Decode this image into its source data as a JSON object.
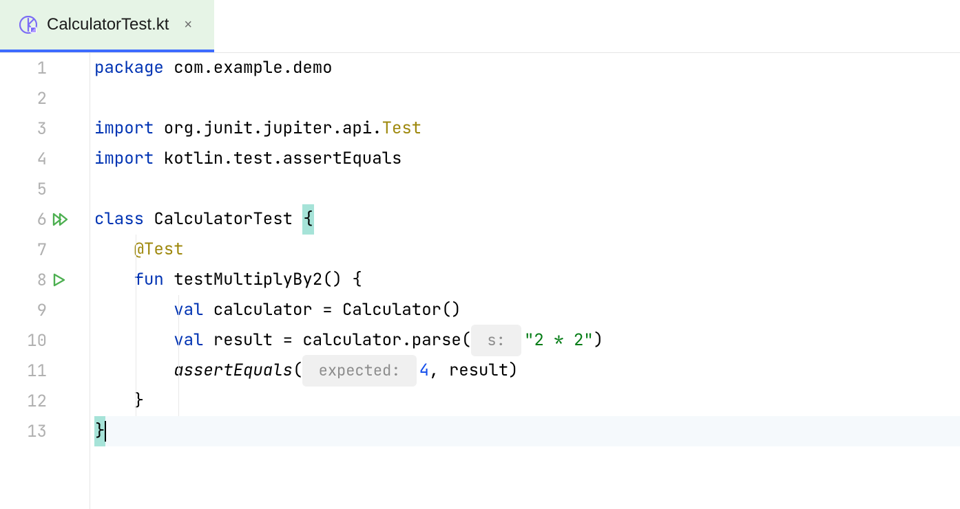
{
  "tab": {
    "filename": "CalculatorTest.kt",
    "close_glyph": "×"
  },
  "gutter": {
    "lines": [
      "1",
      "2",
      "3",
      "4",
      "5",
      "6",
      "7",
      "8",
      "9",
      "10",
      "11",
      "12",
      "13"
    ]
  },
  "code": {
    "l1": {
      "package_kw": "package",
      "pkg": " com.example.demo"
    },
    "l3": {
      "import_kw": "import",
      "path": " org.junit.jupiter.api.",
      "tail": "Test"
    },
    "l4": {
      "import_kw": "import",
      "path": " kotlin.test.assertEquals"
    },
    "l6": {
      "class_kw": "class",
      "name": " CalculatorTest ",
      "brace": "{"
    },
    "l7": {
      "indent": "    ",
      "anno": "@Test"
    },
    "l8": {
      "indent": "    ",
      "fun_kw": "fun",
      "name": " testMultiplyBy2() {"
    },
    "l9": {
      "indent": "        ",
      "val_kw": "val",
      "rest1": " calculator = Calculator()"
    },
    "l10": {
      "indent": "        ",
      "val_kw": "val",
      "rest1": " result = calculator.parse(",
      "hint": " s: ",
      "str": "\"2 * 2\"",
      "rest2": ")"
    },
    "l11": {
      "indent": "        ",
      "call": "assertEquals",
      "open": "(",
      "hint": " expected: ",
      "num": "4",
      "rest": ", result)"
    },
    "l12": {
      "indent": "    ",
      "brace": "}"
    },
    "l13": {
      "brace": "}"
    }
  }
}
